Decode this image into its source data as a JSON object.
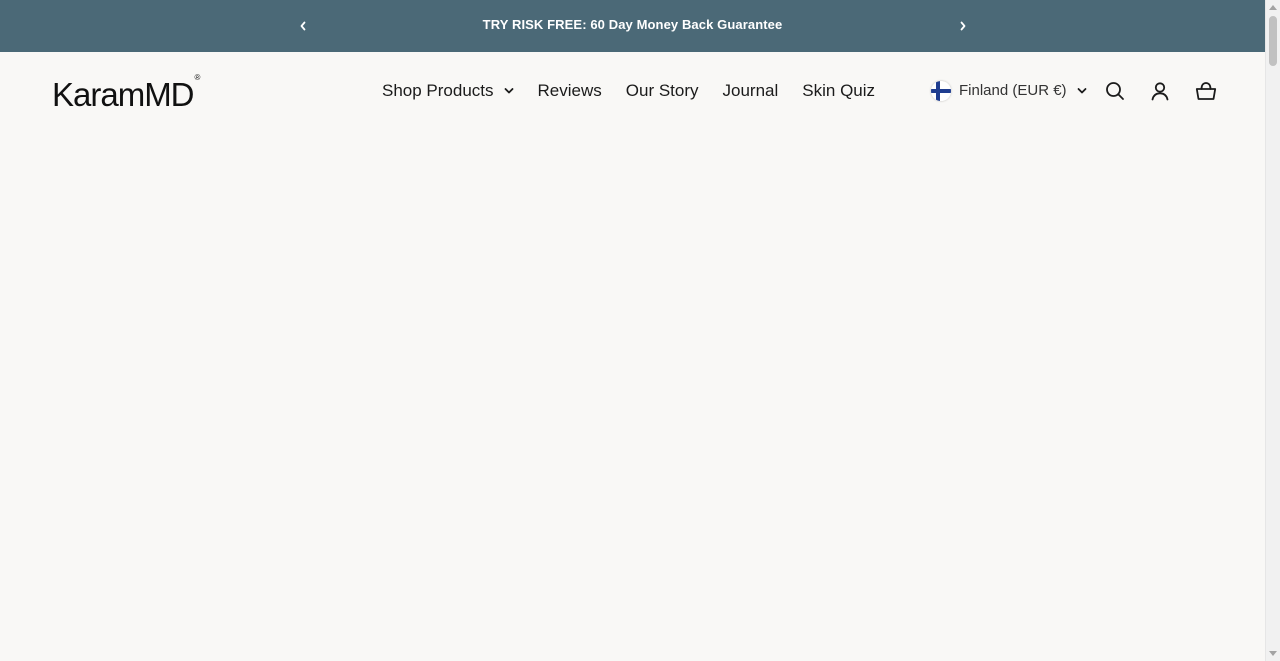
{
  "announcement": {
    "message": "TRY RISK FREE: 60 Day Money Back Guarantee",
    "prev_icon": "chevron-left-icon",
    "next_icon": "chevron-right-icon",
    "background": "#4b6977"
  },
  "header": {
    "logo_text": "KaramMD",
    "logo_mark": "®",
    "nav": [
      {
        "label": "Shop Products",
        "has_dropdown": true
      },
      {
        "label": "Reviews"
      },
      {
        "label": "Our Story"
      },
      {
        "label": "Journal"
      },
      {
        "label": "Skin Quiz"
      }
    ],
    "locale": {
      "label": "Finland (EUR €)",
      "flag_icon": "finland-flag-icon"
    },
    "icons": [
      "search-icon",
      "account-icon",
      "cart-icon"
    ]
  },
  "colors": {
    "page_background": "#f9f8f6",
    "text": "#1b1b1b"
  }
}
